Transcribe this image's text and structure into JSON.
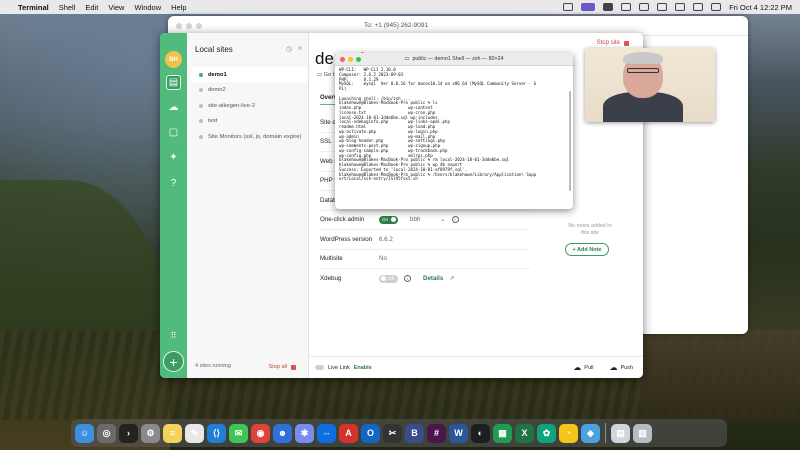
{
  "menubar": {
    "app_name": "Terminal",
    "items": [
      "Shell",
      "Edit",
      "View",
      "Window",
      "Help"
    ],
    "datetime": "Fri Oct 4  12:22 PM"
  },
  "messages": {
    "to_line": "To: +1 (945) 262-9091"
  },
  "local": {
    "avatar_initials": "BH",
    "sidebar_title": "Local sites",
    "sites": [
      {
        "name": "demo1",
        "active": true
      },
      {
        "name": "demo2",
        "active": false
      },
      {
        "name": "site-aikegen-live-2",
        "active": false
      },
      {
        "name": "test",
        "active": false
      },
      {
        "name": "Site Monitors (ssl, js, domain expire)",
        "active": false
      }
    ],
    "running": "4 sites running",
    "stop_all": "Stop all",
    "site_title": "demo1",
    "goto": "Go t",
    "stop_site": "Stop site",
    "tab_overview": "Overv",
    "rows": [
      {
        "key": "Site do",
        "value": ""
      },
      {
        "key": "SSL",
        "value": ""
      },
      {
        "key": "Web s",
        "value": ""
      },
      {
        "key": "PHP v",
        "value": ""
      },
      {
        "key": "Datab",
        "value": ""
      },
      {
        "key": "One-click admin",
        "value": "bbh",
        "toggle": "On"
      },
      {
        "key": "WordPress version",
        "value": "6.6.2"
      },
      {
        "key": "Multisite",
        "value": "No"
      },
      {
        "key": "Xdebug",
        "value": "Details",
        "toggle": "Off"
      }
    ],
    "notes_empty": "No notes added to this site",
    "add_note": "+ Add Note",
    "live_link": "Live Link",
    "enable": "Enable",
    "pull": "Pull",
    "push": "Push"
  },
  "terminal": {
    "title": "public — demo1 Shell — zsh — 80×24",
    "lines": [
      "WP-CLI:   WP-CLI 2.10.0",
      "Composer: 2.6.2 2023-09-03",
      "PHP:      8.1.29",
      "MySQL:    mysql  Ver 8.0.16 for macos10.14 on x86_64 (MySQL Community Server - G",
      "PL)",
      "",
      "Launching shell: /bin/zsh ...",
      "blakehowe@Blakes-MacBook-Pro public % ls",
      "index.php                   wp-content",
      "license.txt                 wp-cron.php",
      "local-2024-10-01-3dde6be.sql wp-includes",
      "local-xdebuginfo.php        wp-links-opml.php",
      "readme.html                 wp-load.php",
      "wp-activate.php             wp-login.php",
      "wp-admin                    wp-mail.php",
      "wp-blog-header.php          wp-settings.php",
      "wp-comments-post.php        wp-signup.php",
      "wp-config-sample.php        wp-trackback.php",
      "wp-config.php               xmlrpc.php",
      "blakehowe@Blakes-MacBook-Pro public % rm local-2024-10-01-3dde6be.sql",
      "blakehowe@Blakes-MacBook-Pro public % wp db export",
      "Success: Exported to 'local-2024-10-01-af8979f.sql'.",
      "blakehowe@Blakes-MacBook-Pro public % /Users/blakehowe/Library/Application\\ Supp",
      "ort/Local/ssh-entry/ISl95fvx5.sh"
    ]
  },
  "dock": {
    "icons": [
      {
        "name": "finder-icon",
        "color": "#3d8fe0",
        "glyph": "☺"
      },
      {
        "name": "launchpad-icon",
        "color": "#6b6b6b",
        "glyph": "◎"
      },
      {
        "name": "terminal-icon",
        "color": "#222222",
        "glyph": "›"
      },
      {
        "name": "settings-icon",
        "color": "#8a8a8a",
        "glyph": "⚙"
      },
      {
        "name": "notes-icon",
        "color": "#f2d15c",
        "glyph": "≡"
      },
      {
        "name": "textedit-icon",
        "color": "#e8e8e8",
        "glyph": "✎"
      },
      {
        "name": "vscode-icon",
        "color": "#1f7ed6",
        "glyph": "⟨⟩"
      },
      {
        "name": "messages-icon",
        "color": "#3fc455",
        "glyph": "✉"
      },
      {
        "name": "chrome-icon",
        "color": "#db4437",
        "glyph": "◉"
      },
      {
        "name": "smile-icon",
        "color": "#2f6fd8",
        "glyph": "☻"
      },
      {
        "name": "claude-icon",
        "color": "#7a8cf0",
        "glyph": "✱"
      },
      {
        "name": "teamviewer-icon",
        "color": "#0e6de0",
        "glyph": "⇔"
      },
      {
        "name": "acrobat-icon",
        "color": "#d4322c",
        "glyph": "A"
      },
      {
        "name": "outlook-icon",
        "color": "#1466c2",
        "glyph": "O"
      },
      {
        "name": "capcut-icon",
        "color": "#333333",
        "glyph": "✂"
      },
      {
        "name": "bbedit-icon",
        "color": "#3c4b8a",
        "glyph": "B"
      },
      {
        "name": "slack-icon",
        "color": "#4a154b",
        "glyph": "#"
      },
      {
        "name": "word-icon",
        "color": "#2b579a",
        "glyph": "W"
      },
      {
        "name": "github-icon",
        "color": "#1b1f23",
        "glyph": "◐"
      },
      {
        "name": "sheets-icon",
        "color": "#1f9d55",
        "glyph": "▦"
      },
      {
        "name": "excel-icon",
        "color": "#217346",
        "glyph": "X"
      },
      {
        "name": "chatgpt-icon",
        "color": "#10a37f",
        "glyph": "✿"
      },
      {
        "name": "cyberduck-icon",
        "color": "#f5c518",
        "glyph": "◔"
      },
      {
        "name": "compass-icon",
        "color": "#4aa3df",
        "glyph": "◈"
      },
      {
        "name": "downloads-icon",
        "color": "#cfd6dd",
        "glyph": "▤"
      },
      {
        "name": "trash-icon",
        "color": "#b8bcc0",
        "glyph": "▥"
      }
    ]
  }
}
